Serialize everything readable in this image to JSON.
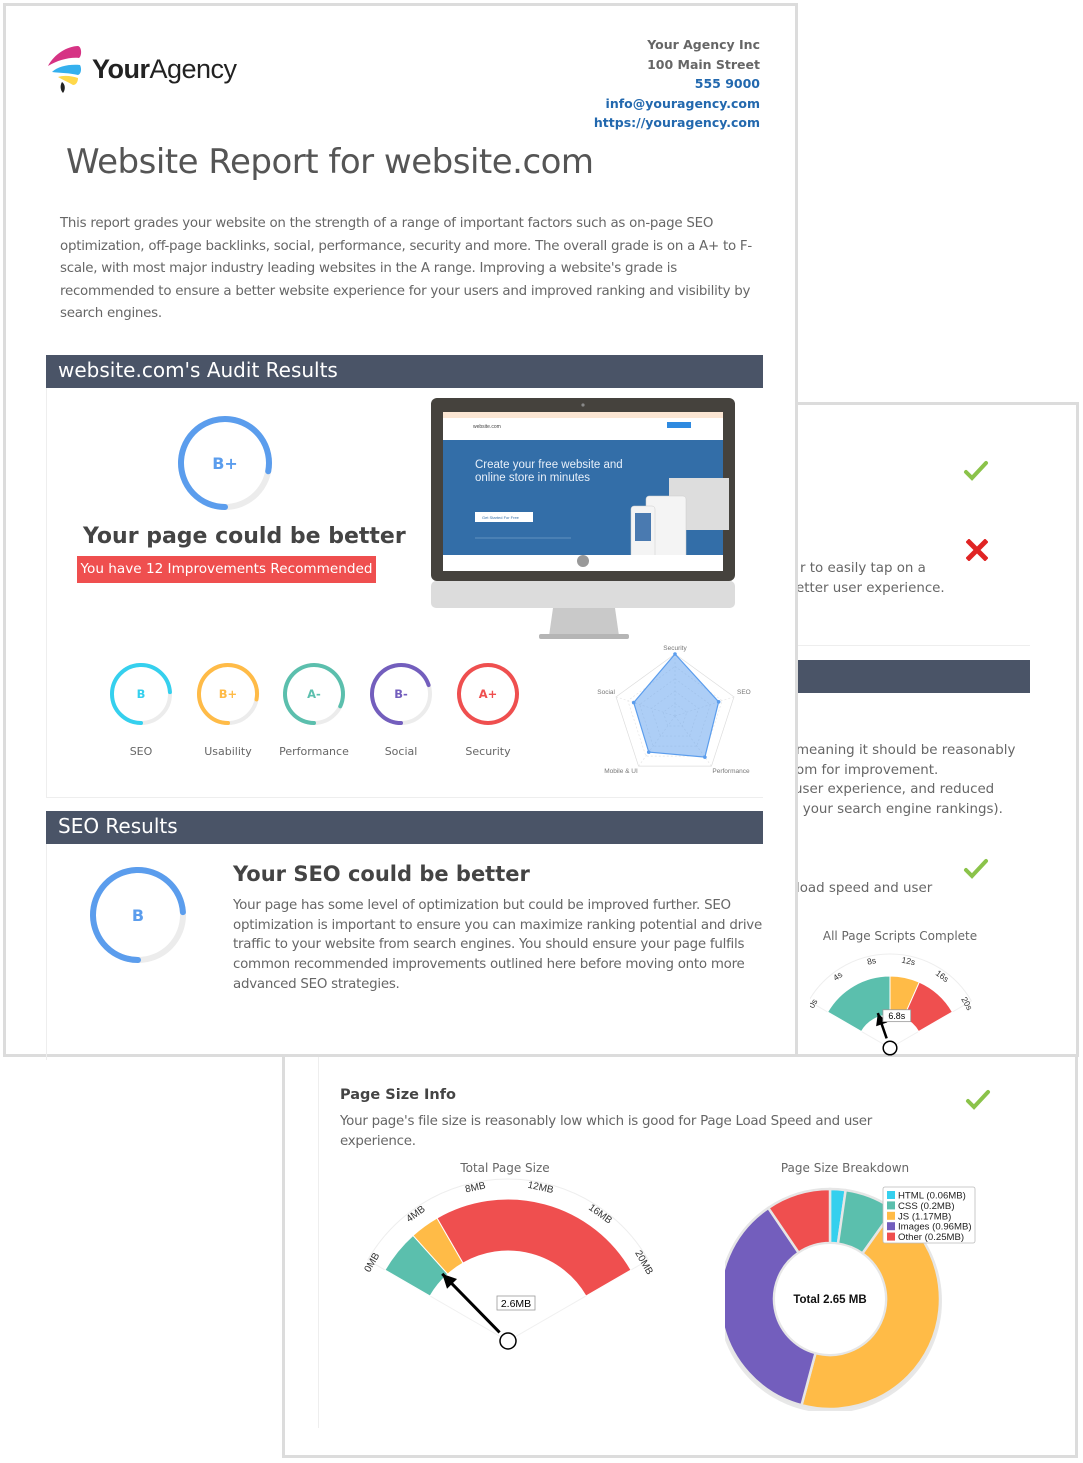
{
  "agency": {
    "name_bold": "Your",
    "name_regular": "Agency",
    "contact": {
      "company": "Your Agency Inc",
      "street": "100 Main Street",
      "phone": "555 9000",
      "email": "info@youragency.com",
      "website": "https://youragency.com"
    }
  },
  "report": {
    "title": "Website Report for website.com",
    "intro": "This report grades your website on the strength of a range of important factors such as on-page SEO optimization, off-page backlinks, social, performance, security and more. The overall grade is on a A+ to F-scale, with most major industry leading websites in the A range. Improving a website's grade is recommended to ensure a better website experience for your users and improved ranking and visibility by search engines."
  },
  "audit": {
    "section_title": "website.com's Audit Results",
    "overall_grade": "B+",
    "overall_score": 0.78,
    "overall_color": "#5b9ded",
    "headline": "Your page could be better",
    "improvements_badge": "You have 12 Improvements Recommended",
    "screenshot": {
      "site_name": "website.com",
      "hero_line1": "Create your free website and",
      "hero_line2": "online store in minutes",
      "cta": "Get Started For Free"
    },
    "categories": [
      {
        "label": "SEO",
        "grade": "B",
        "score": 0.74,
        "color": "#35d0ee"
      },
      {
        "label": "Usability",
        "grade": "B+",
        "score": 0.78,
        "color": "#ffbb47"
      },
      {
        "label": "Performance",
        "grade": "A-",
        "score": 0.82,
        "color": "#5bbfad"
      },
      {
        "label": "Social",
        "grade": "B-",
        "score": 0.7,
        "color": "#735ebd"
      },
      {
        "label": "Security",
        "grade": "A+",
        "score": 1.0,
        "color": "#ef4f4f"
      }
    ]
  },
  "chart_data": [
    {
      "type": "radar",
      "axes": [
        "Security",
        "SEO",
        "Performance",
        "Mobile & UI",
        "Social"
      ],
      "values": [
        1.0,
        0.74,
        0.82,
        0.72,
        0.7
      ],
      "range": [
        0,
        1
      ],
      "color": "#5b9ded"
    },
    {
      "type": "gauge",
      "title": "All Page Scripts Complete",
      "ticks": [
        "0s",
        "4s",
        "8s",
        "12s",
        "16s",
        "20s"
      ],
      "range": [
        0,
        20
      ],
      "bands": [
        {
          "from": 0,
          "to": 10,
          "color": "#5bbfad"
        },
        {
          "from": 10,
          "to": 14,
          "color": "#ffbb47"
        },
        {
          "from": 14,
          "to": 20,
          "color": "#ef4f4f"
        }
      ],
      "value": 6.8,
      "value_label": "6.8s"
    },
    {
      "type": "gauge",
      "title": "Total Page Size",
      "ticks": [
        "0MB",
        "4MB",
        "8MB",
        "12MB",
        "16MB",
        "20MB"
      ],
      "range": [
        0,
        20
      ],
      "bands": [
        {
          "from": 0,
          "to": 3,
          "color": "#5bbfad"
        },
        {
          "from": 3,
          "to": 5,
          "color": "#ffbb47"
        },
        {
          "from": 5,
          "to": 20,
          "color": "#ef4f4f"
        }
      ],
      "value": 2.6,
      "value_label": "2.6MB"
    },
    {
      "type": "pie",
      "title": "Page Size Breakdown",
      "center_label": "Total 2.65 MB",
      "legend_position": "top-right",
      "slices": [
        {
          "label": "HTML (0.06MB)",
          "value": 0.06,
          "color": "#35d0ee"
        },
        {
          "label": "CSS (0.2MB)",
          "value": 0.2,
          "color": "#5bbfad"
        },
        {
          "label": "JS (1.17MB)",
          "value": 1.17,
          "color": "#ffbb47"
        },
        {
          "label": "Images (0.96MB)",
          "value": 0.96,
          "color": "#735ebd"
        },
        {
          "label": "Other (0.25MB)",
          "value": 0.25,
          "color": "#ef4f4f"
        }
      ]
    }
  ],
  "seo": {
    "section_title": "SEO Results",
    "grade": "B",
    "score": 0.74,
    "color": "#5b9ded",
    "headline": "Your SEO could be better",
    "text": "Your page has some level of optimization but could be improved further. SEO optimization is important to ensure you can maximize ranking potential and drive traffic to your website from search engines. You should ensure your page fulfils common recommended improvements outlined here before moving onto more advanced SEO strategies."
  },
  "page2": {
    "tap_line1": "r to easily tap on a",
    "tap_line2": "etter user experience.",
    "speed_lines": [
      "meaning it should be reasonably",
      "om for improvement.",
      "user experience, and reduced",
      ": your search engine rankings)."
    ],
    "load_line": "load speed and user",
    "status_pass_color": "#8bc34a",
    "status_fail_color": "#e02424"
  },
  "page3": {
    "title": "Page Size Info",
    "text": "Your page's file size is reasonably low which is good for Page Load Speed and user experience."
  }
}
